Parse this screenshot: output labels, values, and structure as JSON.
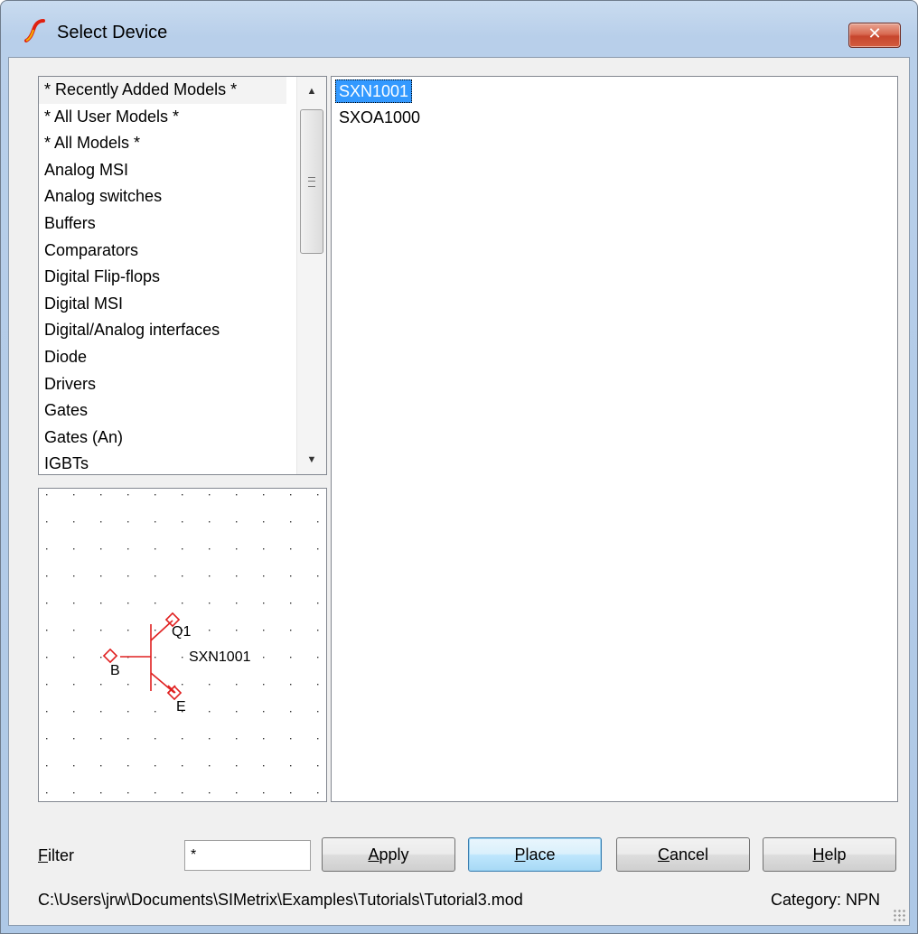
{
  "window": {
    "title": "Select Device",
    "close_glyph": "✕"
  },
  "categories": {
    "items": [
      "* Recently Added Models *",
      "* All User Models *",
      "* All Models *",
      "Analog MSI",
      "Analog switches",
      "Buffers",
      "Comparators",
      "Digital Flip-flops",
      "Digital MSI",
      "Digital/Analog interfaces",
      "Diode",
      "Drivers",
      "Gates",
      "Gates (An)",
      "IGBTs"
    ],
    "scroll_up_glyph": "▲",
    "scroll_down_glyph": "▼"
  },
  "models": {
    "items": [
      "SXN1001",
      "SXOA1000"
    ],
    "selected": "SXN1001"
  },
  "preview": {
    "ref_label": "Q1",
    "model_label": "SXN1001",
    "pin_b": "B",
    "pin_e": "E",
    "symbol_color": "#e02020"
  },
  "filter": {
    "label": "Filter",
    "value": "*"
  },
  "buttons": {
    "apply": "Apply",
    "place": "Place",
    "cancel": "Cancel",
    "help": "Help"
  },
  "status": {
    "path": "C:\\Users\\jrw\\Documents\\SIMetrix\\Examples\\Tutorials\\Tutorial3.mod",
    "category": "Category: NPN"
  },
  "colors": {
    "selection": "#3399ff",
    "titlebar": "#b8cfea"
  }
}
